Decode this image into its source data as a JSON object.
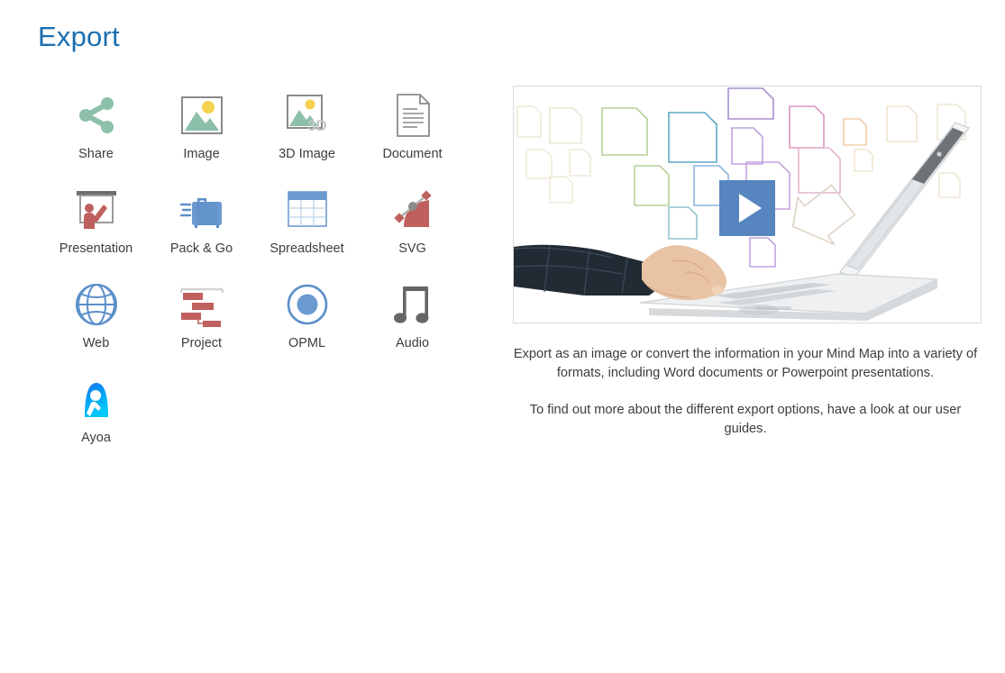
{
  "page": {
    "title": "Export",
    "title_color": "#1b6fb0"
  },
  "export_options": [
    {
      "id": "share",
      "label": "Share",
      "icon": "share-icon",
      "color": "#8cc0a8"
    },
    {
      "id": "image",
      "label": "Image",
      "icon": "image-icon",
      "color": "#8cc0a8"
    },
    {
      "id": "3d-image",
      "label": "3D Image",
      "icon": "3d-image-icon",
      "color": "#8cc0a8"
    },
    {
      "id": "document",
      "label": "Document",
      "icon": "document-icon",
      "color": "#8a8a8a"
    },
    {
      "id": "presentation",
      "label": "Presentation",
      "icon": "presentation-icon",
      "color": "#c0605e"
    },
    {
      "id": "pack-and-go",
      "label": "Pack & Go",
      "icon": "briefcase-icon",
      "color": "#5b8fc9"
    },
    {
      "id": "spreadsheet",
      "label": "Spreadsheet",
      "icon": "spreadsheet-icon",
      "color": "#5b8fc9"
    },
    {
      "id": "svg",
      "label": "SVG",
      "icon": "svg-icon",
      "color": "#c0605e"
    },
    {
      "id": "web",
      "label": "Web",
      "icon": "globe-icon",
      "color": "#5b8fc9"
    },
    {
      "id": "project",
      "label": "Project",
      "icon": "gantt-icon",
      "color": "#c0605e"
    },
    {
      "id": "opml",
      "label": "OPML",
      "icon": "opml-icon",
      "color": "#5b8fc9"
    },
    {
      "id": "audio",
      "label": "Audio",
      "icon": "music-note-icon",
      "color": "#666666"
    },
    {
      "id": "ayoa",
      "label": "Ayoa",
      "icon": "ayoa-icon",
      "color": "#00b0f0"
    }
  ],
  "preview": {
    "video_thumbnail_name": "export-video-thumbnail",
    "play_button_label": "",
    "description_1": "Export as an image or convert the information in your Mind Map into a variety of formats, including Word documents or Powerpoint presentations.",
    "description_2": "To find out more about the different export options, have a look at our user guides."
  },
  "icon_palette": {
    "sage_green": "#8cc0a8",
    "sun_yellow": "#f5d24e",
    "frame_gray": "#8a8a8a",
    "brick_red": "#c0605e",
    "steel_blue": "#5b8fc9",
    "play_blue": "#5685bf",
    "note_gray": "#666666",
    "ayoa_cyan": "#00b0f0",
    "ayoa_blue": "#1a6ff0"
  }
}
